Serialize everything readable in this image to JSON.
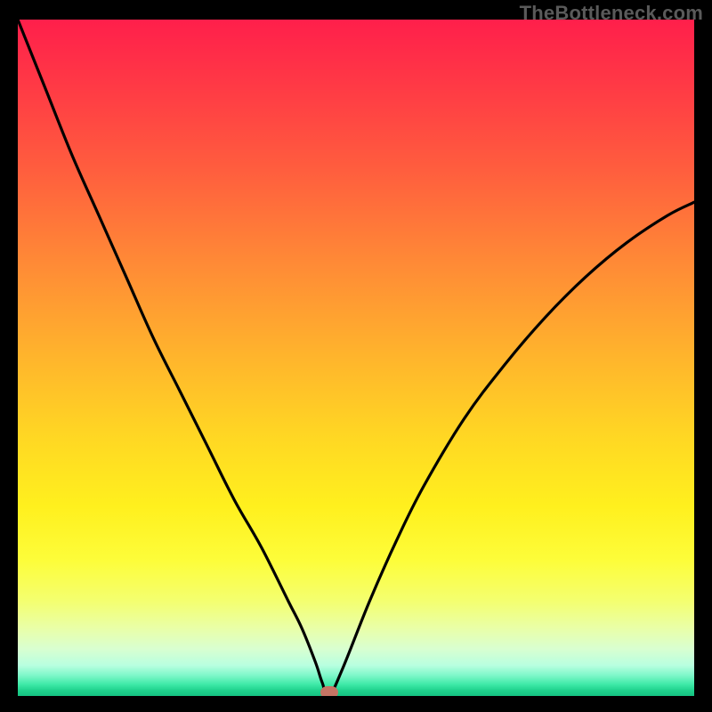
{
  "watermark": "TheBottleneck.com",
  "chart_data": {
    "type": "line",
    "title": "",
    "xlabel": "",
    "ylabel": "",
    "xlim": [
      0,
      100
    ],
    "ylim": [
      0,
      100
    ],
    "grid": false,
    "series": [
      {
        "name": "bottleneck-curve",
        "x": [
          0,
          4,
          8,
          12,
          16,
          20,
          24,
          28,
          32,
          36,
          40,
          42,
          44,
          45,
          46,
          48,
          52,
          56,
          60,
          66,
          72,
          78,
          84,
          90,
          96,
          100
        ],
        "y": [
          100,
          90,
          80,
          71,
          62,
          53,
          45,
          37,
          29,
          22,
          14,
          10,
          5,
          2,
          0,
          4,
          14,
          23,
          31,
          41,
          49,
          56,
          62,
          67,
          71,
          73
        ]
      }
    ],
    "marker": {
      "x": 46,
      "y": 0.5,
      "color": "#c57464"
    },
    "background_gradient": {
      "stops": [
        {
          "pos": 0,
          "color": "#ff1f4b"
        },
        {
          "pos": 50,
          "color": "#ffb52c"
        },
        {
          "pos": 80,
          "color": "#fdfd3a"
        },
        {
          "pos": 100,
          "color": "#15c181"
        }
      ]
    }
  }
}
